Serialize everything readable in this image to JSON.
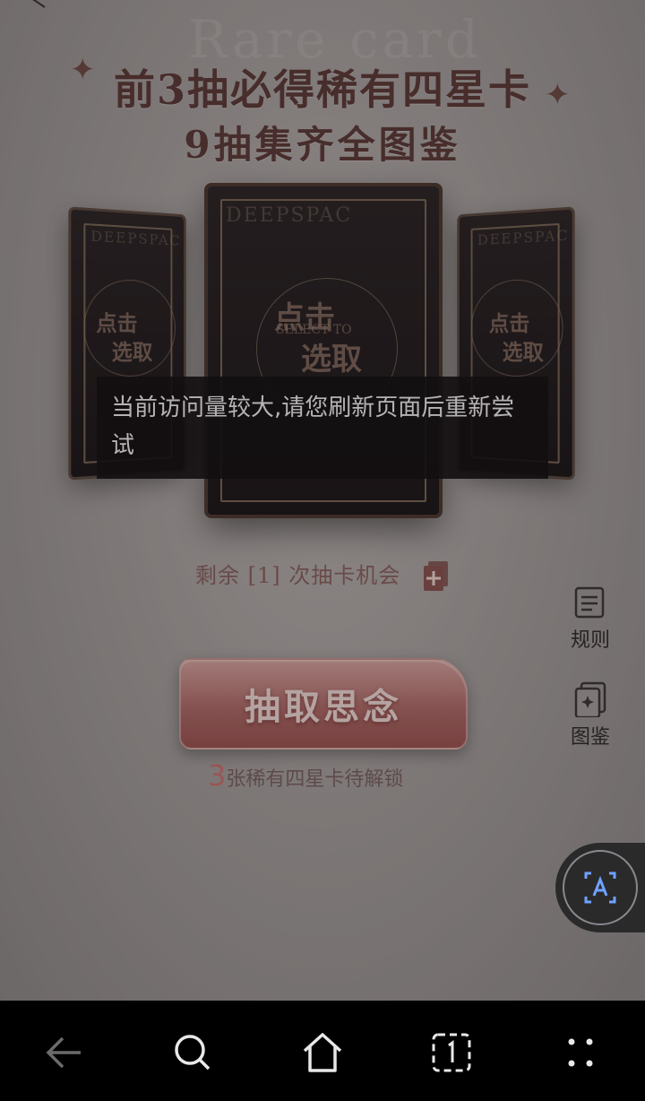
{
  "header": {
    "watermark": "Rare card",
    "line1": "前3抽必得稀有四星卡",
    "line2": "9抽集齐全图鉴"
  },
  "cards": {
    "pick_text_top": "点击",
    "pick_text_bottom": "选取",
    "brand": "DEEPSPAC",
    "sub": "SELECT TO"
  },
  "toast": {
    "message": "当前访问量较大,请您刷新页面后重新尝试"
  },
  "draw": {
    "remain_prefix": "剩余",
    "remain_count": "[1]",
    "remain_suffix": "次抽卡机会",
    "button_label": "抽取思念",
    "unlock_count": "3",
    "unlock_text": "张稀有四星卡待解锁"
  },
  "side": {
    "rules_label": "规则",
    "atlas_label": "图鉴"
  },
  "nav": {
    "icons": [
      "back-icon",
      "search-icon",
      "home-icon",
      "tabs-icon",
      "more-icon"
    ]
  },
  "colors": {
    "accent": "#d96664",
    "button": "#b06c6a",
    "navbar": "#000000"
  }
}
